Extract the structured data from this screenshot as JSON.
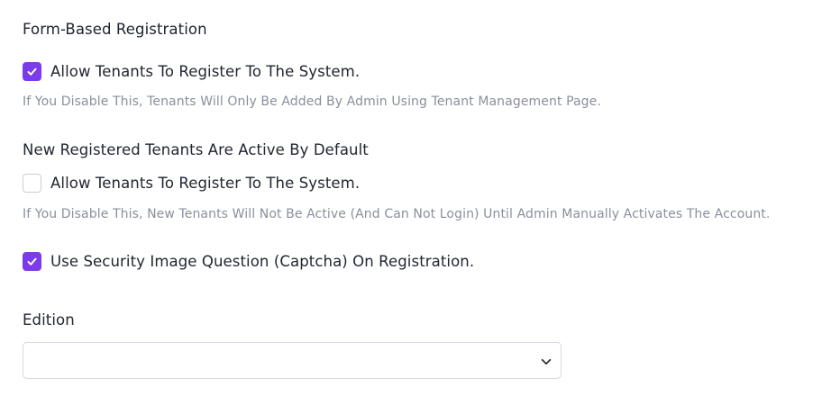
{
  "section": {
    "title": "Form-Based Registration"
  },
  "allow_register": {
    "checked": true,
    "label": "Allow Tenants To Register To The System.",
    "hint": "If You Disable This, Tenants Will Only Be Added By Admin Using Tenant Management Page."
  },
  "new_active": {
    "title": "New Registered Tenants Are Active By Default",
    "checked": false,
    "label": "Allow Tenants To Register To The System.",
    "hint": "If You Disable This, New Tenants Will Not Be Active (And Can Not Login) Until Admin Manually Activates The Account."
  },
  "captcha": {
    "checked": true,
    "label": "Use Security Image Question (Captcha) On Registration."
  },
  "edition": {
    "label": "Edition",
    "selected": ""
  },
  "colors": {
    "accent": "#7c3aed",
    "hint": "#8a8f9c"
  },
  "icons": {
    "check": "check-icon",
    "chevron": "chevron-down-icon"
  }
}
